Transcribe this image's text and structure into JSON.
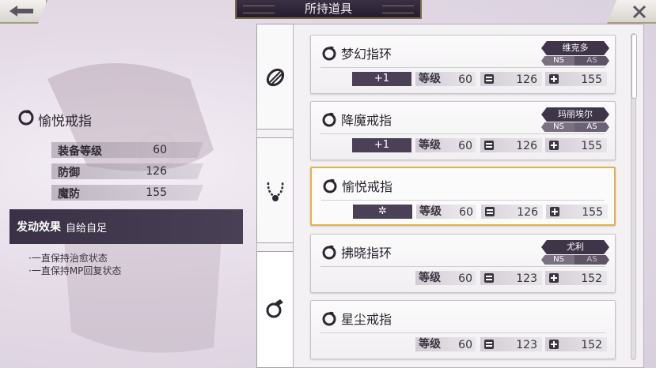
{
  "header": {
    "title": "所持道具"
  },
  "detail": {
    "name": "愉悦戒指",
    "stats": [
      {
        "label": "装备等级",
        "value": "60"
      },
      {
        "label": "防御",
        "value": "126"
      },
      {
        "label": "魔防",
        "value": "155"
      }
    ],
    "effect_title": "发动效果",
    "effect_value": "自给自足",
    "effect_lines": [
      "·一直保持治愈状态",
      "·一直保持MP回复状态"
    ]
  },
  "tabs": [
    {
      "icon": "bracelet-icon"
    },
    {
      "icon": "necklace-icon"
    },
    {
      "icon": "ring-icon"
    }
  ],
  "items": [
    {
      "name": "梦幻指环",
      "owner": "维克多",
      "ns": "NS",
      "as": "AS",
      "plus": "+1",
      "level_label": "等级",
      "level": "60",
      "def": "126",
      "mdef": "155"
    },
    {
      "name": "降魔戒指",
      "owner": "玛丽埃尔",
      "ns": "NS",
      "as": "AS",
      "plus": "+1",
      "level_label": "等级",
      "level": "60",
      "def": "126",
      "mdef": "155"
    },
    {
      "name": "愉悦戒指",
      "owner": "",
      "ns": "",
      "as": "",
      "plus": "✲",
      "level_label": "等级",
      "level": "60",
      "def": "126",
      "mdef": "155"
    },
    {
      "name": "拂晓指环",
      "owner": "尤利",
      "ns": "NS",
      "as": "AS",
      "plus": "",
      "level_label": "等级",
      "level": "60",
      "def": "123",
      "mdef": "152"
    },
    {
      "name": "星尘戒指",
      "owner": "",
      "ns": "",
      "as": "",
      "plus": "",
      "level_label": "等级",
      "level": "60",
      "def": "123",
      "mdef": "152"
    }
  ],
  "colors": {
    "accent_selected": "#e0b24d",
    "dark_panel": "#3e3549"
  }
}
